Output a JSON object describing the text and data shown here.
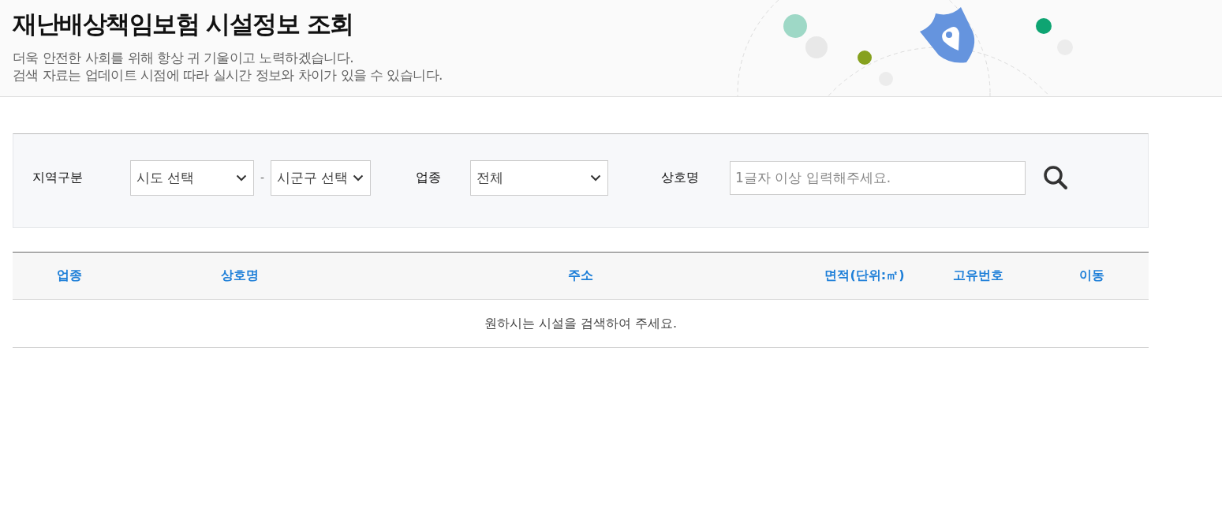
{
  "header": {
    "title": "재난배상책임보험 시설정보 조회",
    "description": [
      "더욱 안전한 사회를 위해 항상 귀 기울이고 노력하겠습니다.",
      "검색 자료는 업데이트 시점에 따라 실시간 정보와 차이가 있을 수 있습니다."
    ]
  },
  "filters": {
    "region": {
      "label": "지역구분",
      "selects": [
        {
          "value": "시도 선택"
        },
        {
          "value": "시군구 선택"
        }
      ],
      "separator": "-"
    },
    "industry": {
      "label": "업종",
      "value": "전체"
    },
    "business_name": {
      "label": "상호명",
      "placeholder": "1글자 이상 입력해주세요."
    }
  },
  "table": {
    "columns": [
      "업종",
      "상호명",
      "주소",
      "면적(단위:㎡)",
      "고유번호",
      "이동"
    ],
    "empty_message": "원하시는 시설을 검색하여 주세요."
  }
}
